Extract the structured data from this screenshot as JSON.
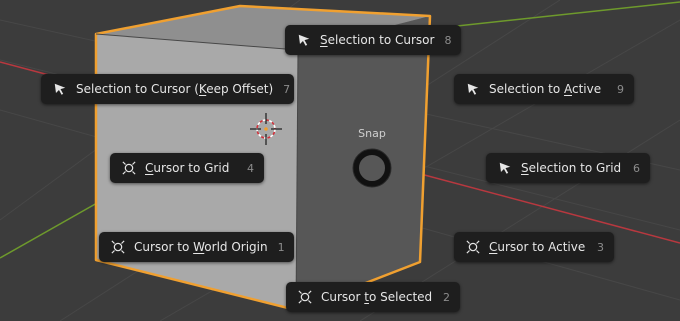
{
  "pie_menu": {
    "title": "Snap",
    "items": [
      {
        "id": "selection-to-cursor",
        "pre": "",
        "u": "S",
        "post": "election to Cursor",
        "key": "8",
        "icon": "cursor-arrow-icon"
      },
      {
        "id": "selection-to-cursor-keep-offset",
        "pre": "Selection to Cursor (",
        "u": "K",
        "post": "eep Offset)",
        "key": "7",
        "icon": "cursor-arrow-icon"
      },
      {
        "id": "selection-to-active",
        "pre": "Selection to ",
        "u": "A",
        "post": "ctive",
        "key": "9",
        "icon": "cursor-arrow-icon"
      },
      {
        "id": "cursor-to-grid",
        "pre": "",
        "u": "C",
        "post": "ursor to Grid",
        "key": "4",
        "icon": "3d-cursor-icon"
      },
      {
        "id": "selection-to-grid",
        "pre": "",
        "u": "S",
        "post": "election to Grid",
        "key": "6",
        "icon": "cursor-arrow-icon"
      },
      {
        "id": "cursor-to-world-origin",
        "pre": "Cursor to ",
        "u": "W",
        "post": "orld Origin",
        "key": "1",
        "icon": "3d-cursor-icon"
      },
      {
        "id": "cursor-to-active",
        "pre": "",
        "u": "C",
        "post": "ursor to Active",
        "key": "3",
        "icon": "3d-cursor-icon"
      },
      {
        "id": "cursor-to-selected",
        "pre": "Cursor ",
        "u": "t",
        "post": "o Selected",
        "key": "2",
        "icon": "3d-cursor-icon"
      }
    ]
  },
  "colors": {
    "viewport_bg": "#3d3d3d",
    "item_bg": "#1e1e1e",
    "item_text": "#e6e6e6",
    "hotkey_text": "#8c8c8c",
    "selection_outline": "#f0a030",
    "x_axis": "#b8383f",
    "y_axis": "#6e9a2c"
  }
}
